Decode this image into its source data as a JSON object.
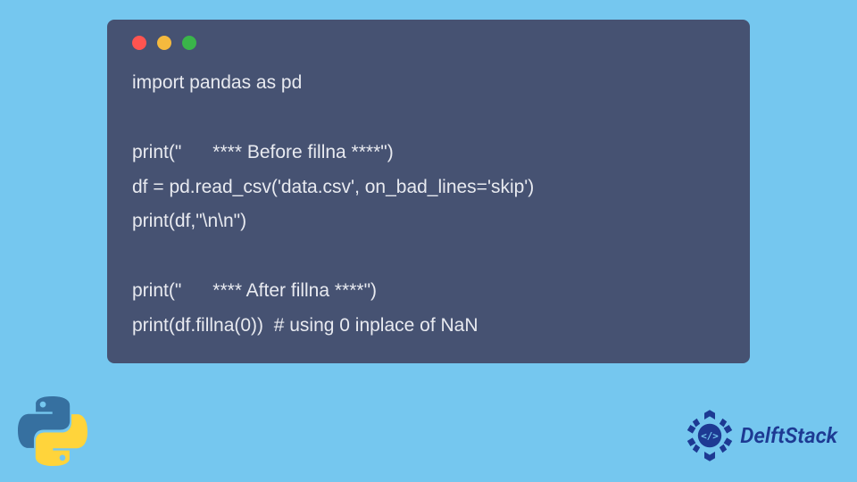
{
  "code": {
    "lines": [
      "import pandas as pd",
      "",
      "print(\"      **** Before fillna ****\")",
      "df = pd.read_csv('data.csv', on_bad_lines='skip')",
      "print(df,\"\\n\\n\")",
      "",
      "print(\"      **** After fillna ****\")",
      "print(df.fillna(0))  # using 0 inplace of NaN"
    ]
  },
  "window_controls": {
    "colors": [
      "#ff5450",
      "#f4b93e",
      "#3ab54a"
    ]
  },
  "logos": {
    "python": {
      "name": "python-icon"
    },
    "delftstack": {
      "name": "delftstack-icon",
      "label": "DelftStack"
    }
  }
}
